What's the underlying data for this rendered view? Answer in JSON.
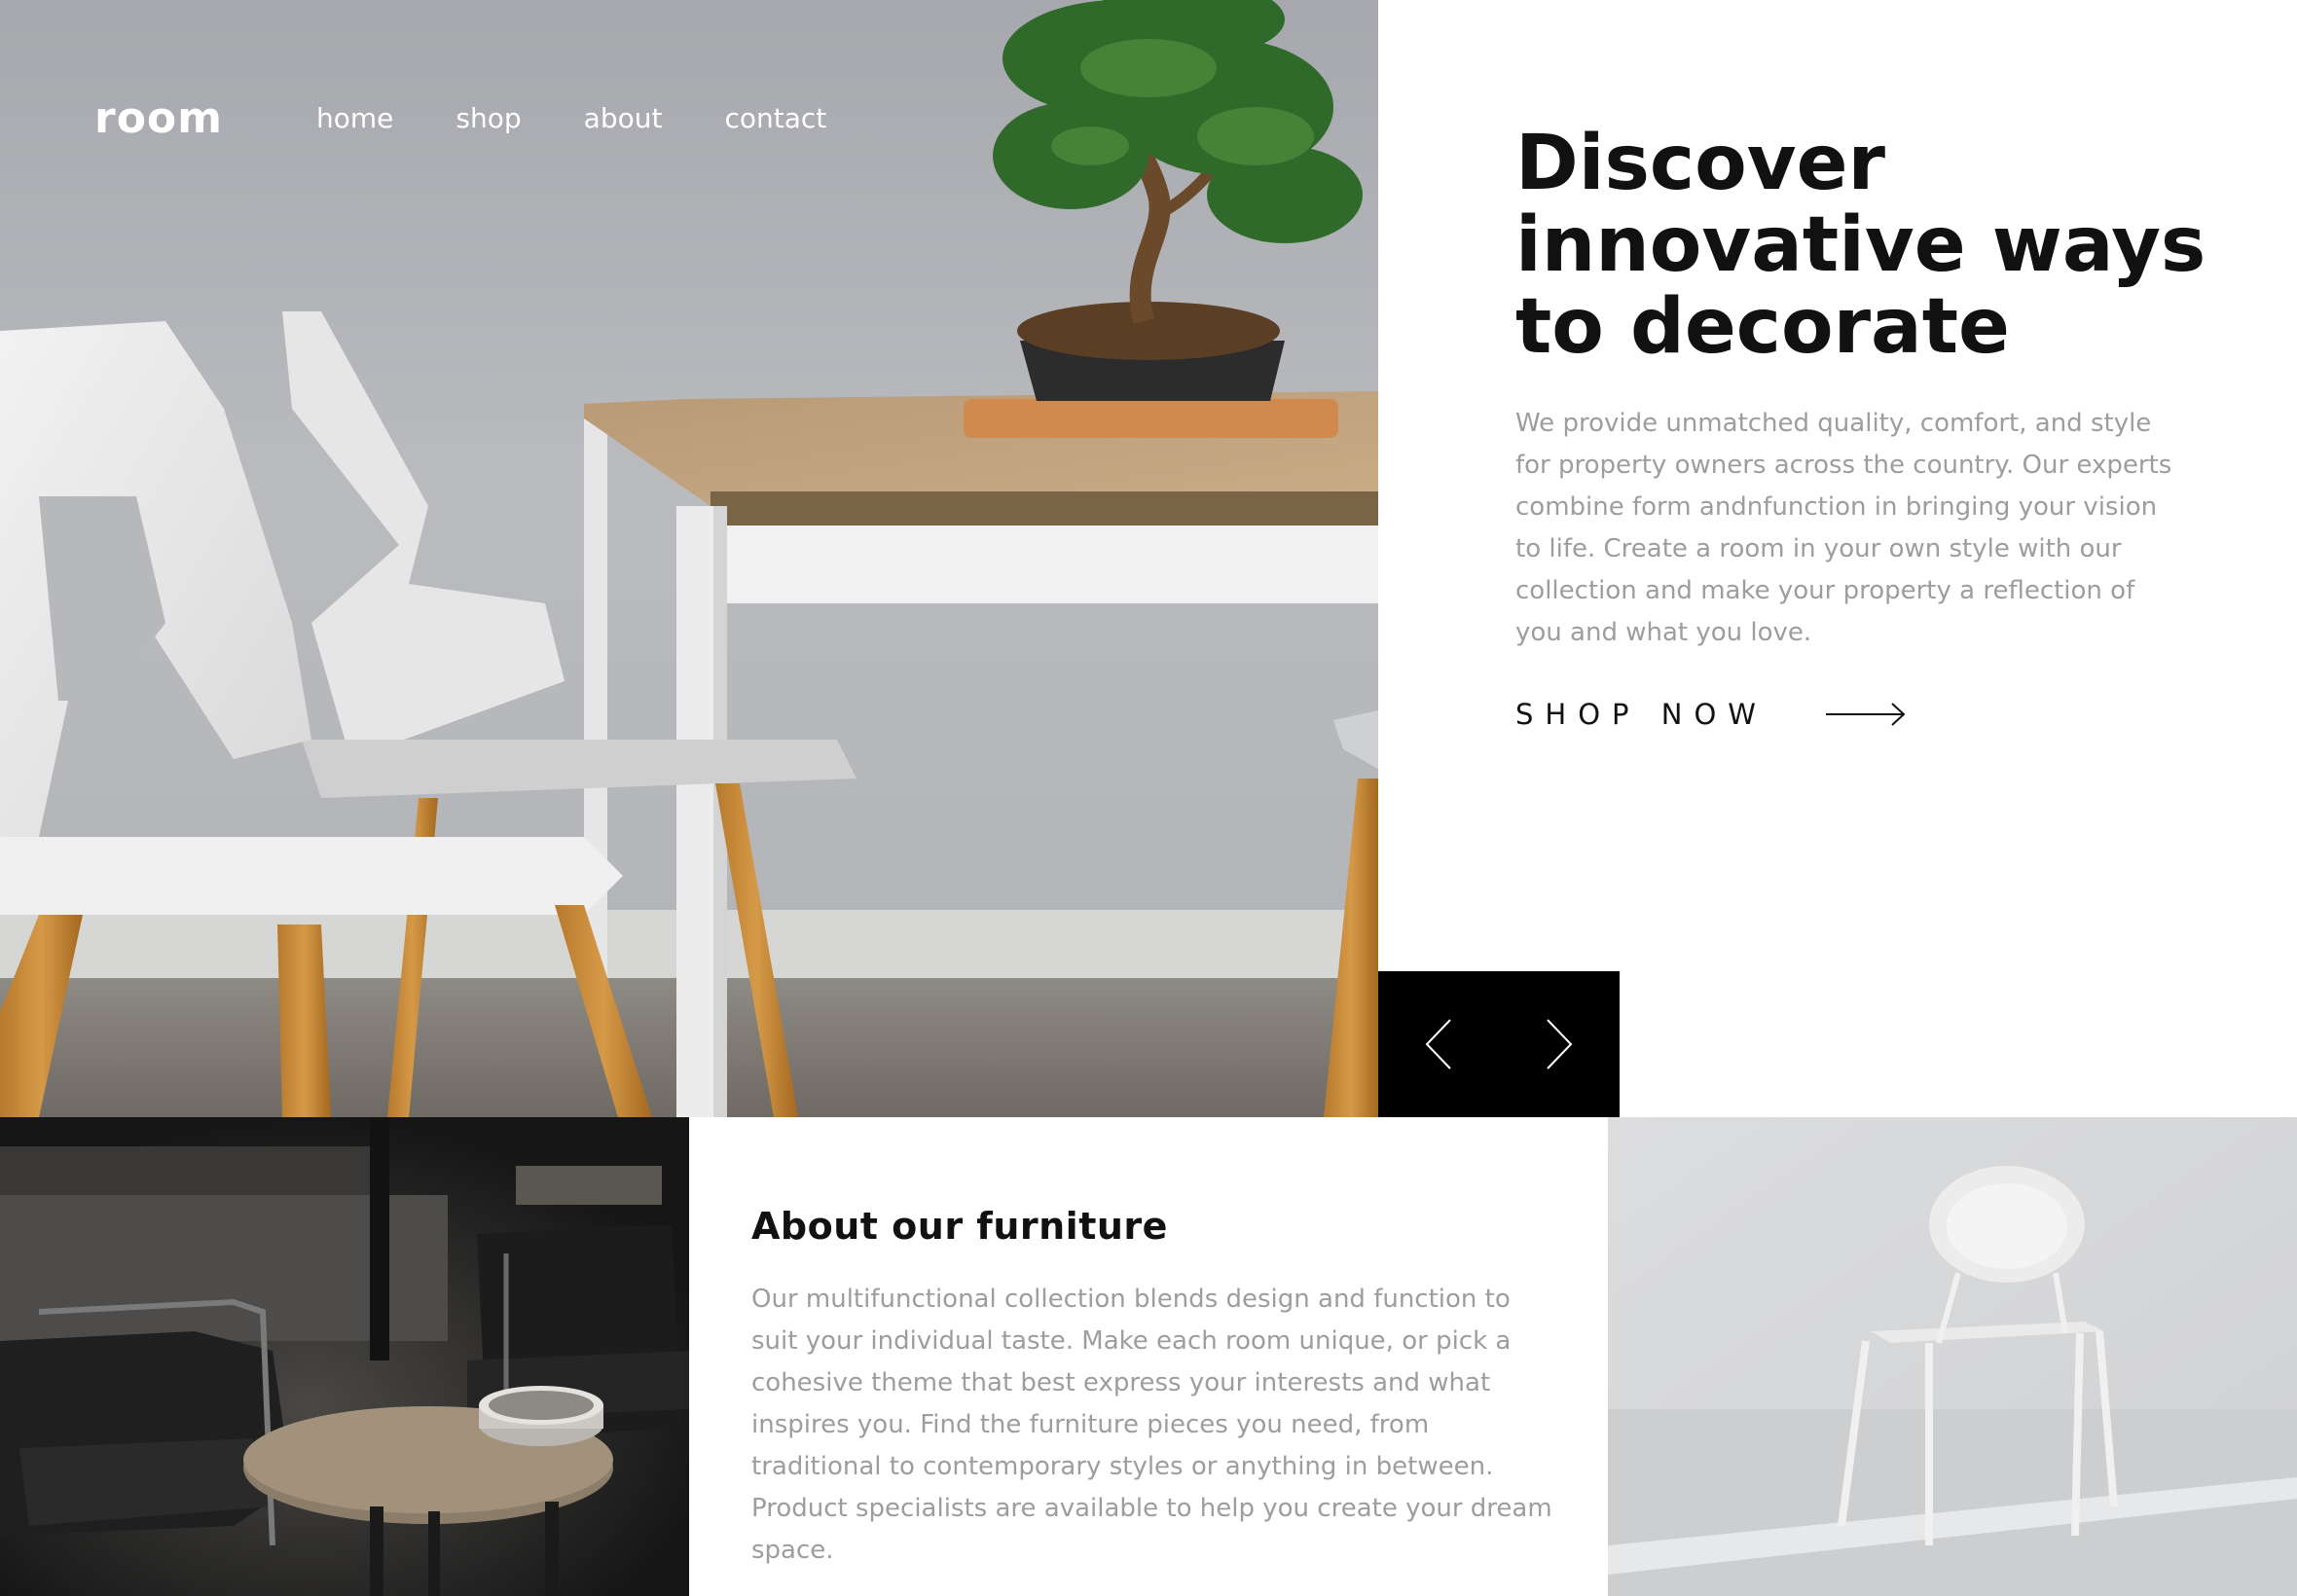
{
  "header": {
    "logo": "room",
    "nav": [
      {
        "label": "home"
      },
      {
        "label": "shop"
      },
      {
        "label": "about"
      },
      {
        "label": "contact"
      }
    ]
  },
  "hero": {
    "title": "Discover innovative ways to decorate",
    "description": "We provide unmatched quality, comfort, and style for property owners across the country. Our experts combine form andnfunction in bringing your vision to life. Create a room in your own style with our collection and make your property a reflection of you and what you love.",
    "cta_label": "SHOP NOW",
    "cta_icon": "arrow-right-icon"
  },
  "slider": {
    "prev_icon": "chevron-left-icon",
    "next_icon": "chevron-right-icon"
  },
  "about": {
    "title": "About our furniture",
    "description": "Our multifunctional collection blends design and function to suit your individual taste. Make each room unique, or pick a cohesive theme that best express your interests and what inspires you. Find the furniture pieces you need, from traditional to contemporary styles or anything in between. Product specialists are available to help you create your dream space."
  },
  "colors": {
    "text_dark": "#111111",
    "text_muted": "#9d9d9d",
    "slider_bg": "#000000",
    "background": "#ffffff"
  }
}
